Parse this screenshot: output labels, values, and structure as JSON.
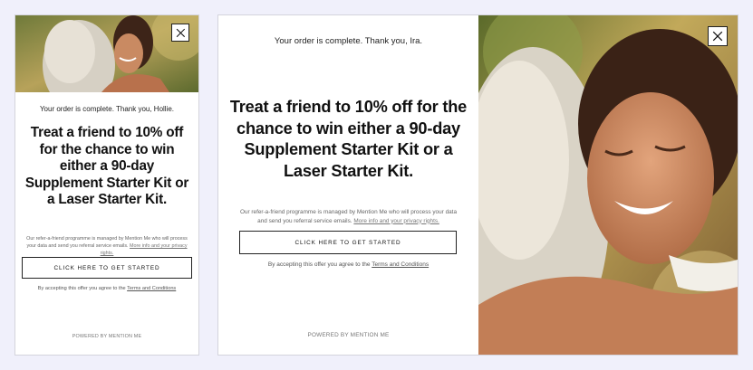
{
  "mobile": {
    "thanks": "Your order is complete. Thank you, Hollie.",
    "headline": "Treat a friend to 10% off for the chance to win either a 90-day Supplement Starter Kit or a Laser Starter Kit.",
    "legal_text": "Our refer-a-friend programme is managed by Mention Me who will process your data and send you referral service emails.",
    "legal_link": "More info and your privacy rights.",
    "cta_label": "CLICK HERE TO GET STARTED",
    "accept_text": "By accepting this offer you agree to the",
    "accept_link": "Terms and Conditions",
    "powered": "POWERED BY MENTION ME"
  },
  "desktop": {
    "thanks": "Your order is complete. Thank you, Ira.",
    "headline": "Treat a friend to 10% off for the chance to win either a 90-day Supplement Starter Kit or a Laser Starter Kit.",
    "legal_text": "Our refer-a-friend programme is managed by Mention Me who will process your data and send you referral service emails.",
    "legal_link": "More info and your privacy rights.",
    "cta_label": "CLICK HERE TO GET STARTED",
    "accept_text": "By accepting this offer you agree to the",
    "accept_link": "Terms and Conditions",
    "powered": "POWERED BY MENTION ME"
  },
  "icons": {
    "close": "close-icon",
    "photo": "hugging-women-photo"
  },
  "colors": {
    "background": "#f0f0fb",
    "card": "#ffffff",
    "text": "#111111",
    "muted": "#666666"
  }
}
